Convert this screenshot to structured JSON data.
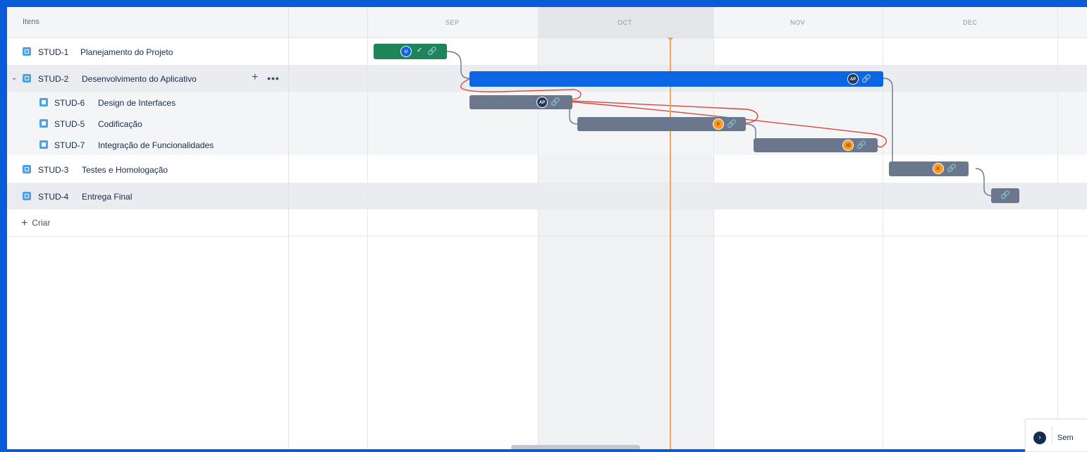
{
  "list": {
    "header": "Itens",
    "items": [
      {
        "key": "STUD-1",
        "title": "Planejamento do Projeto"
      },
      {
        "key": "STUD-2",
        "title": "Desenvolvimento do Aplicativo"
      },
      {
        "key": "STUD-6",
        "title": "Design de Interfaces"
      },
      {
        "key": "STUD-5",
        "title": "Codificação"
      },
      {
        "key": "STUD-7",
        "title": "Integração de Funcionalidades"
      },
      {
        "key": "STUD-3",
        "title": "Testes e Homologação"
      },
      {
        "key": "STUD-4",
        "title": "Entrega Final"
      }
    ],
    "create_label": "Criar",
    "row_actions": {
      "add": "+",
      "more": "•••"
    }
  },
  "timeline": {
    "months": [
      "SEP",
      "OCT",
      "NOV",
      "DEC"
    ],
    "avatars": [
      "U",
      "AP",
      "AP",
      "P",
      "JD",
      "K"
    ]
  },
  "colors": {
    "done": "#1f845a",
    "epic_bar": "#0c66e4",
    "task_bar": "#6b778c",
    "today_line": "#f4a45a",
    "dependency_conflict": "#d7483a",
    "dependency": "#6b778c"
  },
  "zoom": {
    "label": "Sem"
  }
}
